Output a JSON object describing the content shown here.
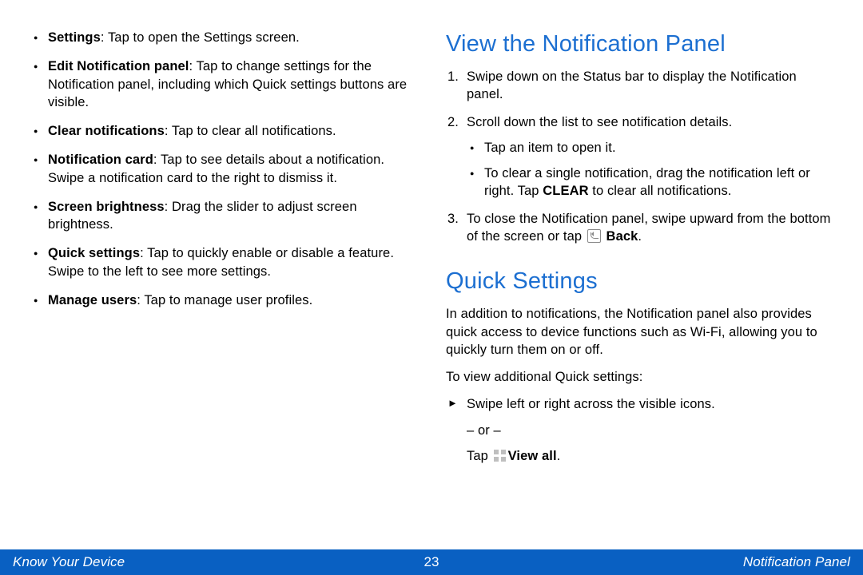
{
  "left": {
    "items": [
      {
        "term": "Settings",
        "desc": ": Tap to open the Settings screen."
      },
      {
        "term": "Edit Notification panel",
        "desc": ": Tap to change settings for the Notification panel, including which Quick settings buttons are visible."
      },
      {
        "term": "Clear notifications",
        "desc": ": Tap to clear all notifications."
      },
      {
        "term": "Notification card",
        "desc": ": Tap to see details about a notification. Swipe a notification card to the right to dismiss it."
      },
      {
        "term": "Screen brightness",
        "desc": ": Drag the slider to adjust screen brightness."
      },
      {
        "term": "Quick settings",
        "desc": ": Tap to quickly enable or disable a feature. Swipe to the left to see more settings."
      },
      {
        "term": "Manage users",
        "desc": ": Tap to manage user profiles."
      }
    ]
  },
  "right": {
    "heading1": "View the Notification Panel",
    "step1": "Swipe down on the Status bar to display the Notification panel.",
    "step2": "Scroll down the list to see notification details.",
    "step2_sub1": "Tap an item to open it.",
    "step2_sub2_pre": "To clear a single notification, drag the notification left or right. Tap ",
    "step2_sub2_bold": "CLEAR",
    "step2_sub2_post": " to clear all notifications.",
    "step3_pre": "To close the Notification panel, swipe upward from the bottom of the screen or tap ",
    "step3_bold": "Back",
    "step3_post": ".",
    "heading2": "Quick Settings",
    "qs_para": "In addition to notifications, the Notification panel also provides quick access to device functions such as Wi-Fi, allowing you to quickly turn them on or off.",
    "qs_lead": "To view additional Quick settings:",
    "qs_arrow": "Swipe left or right across the visible icons.",
    "qs_or": "– or –",
    "qs_tap_pre": "Tap ",
    "qs_tap_bold": "View all",
    "qs_tap_post": "."
  },
  "footer": {
    "left": "Know Your Device",
    "center": "23",
    "right": "Notification Panel"
  }
}
